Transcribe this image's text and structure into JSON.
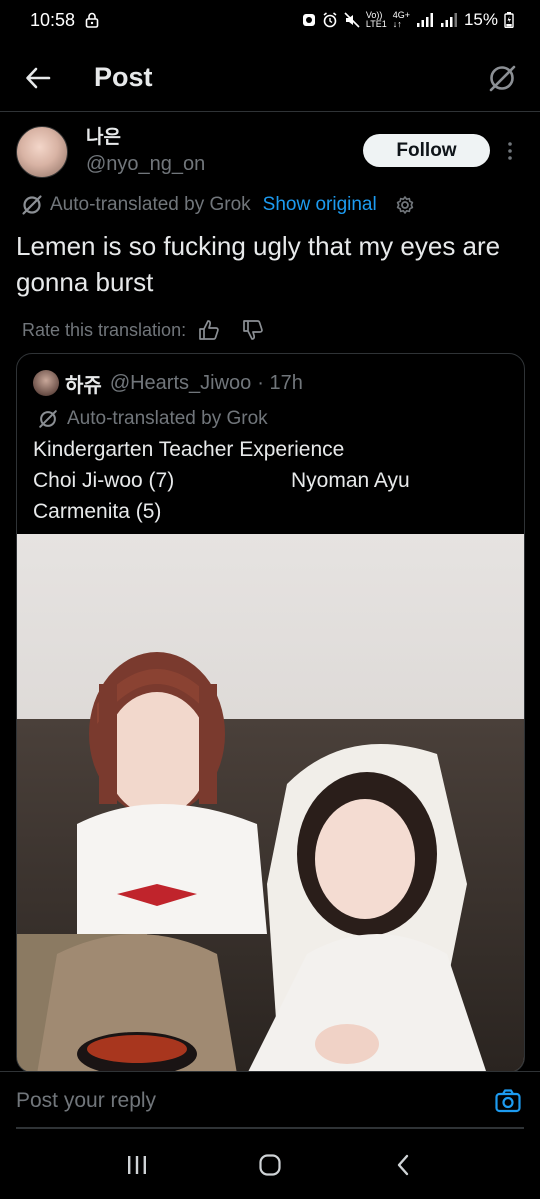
{
  "status_bar": {
    "time": "10:58",
    "network_top": "Vo))",
    "network_bottom": "LTE1",
    "signal_type_top": "4G+",
    "signal_type_bottom": "↓↑",
    "battery": "15%"
  },
  "header": {
    "title": "Post"
  },
  "post": {
    "display_name": "나은",
    "handle": "@nyo_ng_on",
    "follow_label": "Follow",
    "translation_label": "Auto-translated by Grok",
    "show_original_label": "Show original",
    "text": "Lemen is so fucking ugly that my eyes are gonna burst",
    "rate_label": "Rate this translation:"
  },
  "quote": {
    "display_name": "하쥬",
    "handle": "@Hearts_Jiwoo",
    "time": "· 17h",
    "translation_label": "Auto-translated by Grok",
    "line1": "Kindergarten Teacher Experience",
    "line2_left": "Choi Ji-woo (7)",
    "line2_right": "Nyoman Ayu",
    "line3": "Carmenita (5)"
  },
  "reply": {
    "placeholder": "Post your reply"
  },
  "colors": {
    "background": "#000000",
    "text_primary": "#e7e9ea",
    "text_secondary": "#71767b",
    "accent": "#1d9bf0",
    "border": "#2f3336"
  }
}
